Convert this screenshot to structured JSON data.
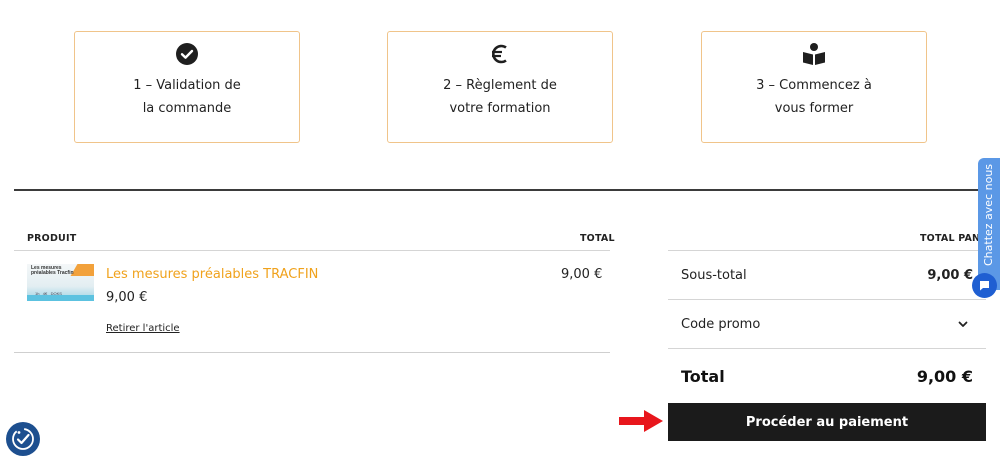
{
  "steps": [
    {
      "icon": "check-circle-icon",
      "line1": "1 – Validation de",
      "line2": "la commande"
    },
    {
      "icon": "euro-icon",
      "line1": "2 – Règlement de",
      "line2": "votre formation"
    },
    {
      "icon": "reader-icon",
      "line1": "3 – Commencez à",
      "line2": "vous former"
    }
  ],
  "cart": {
    "col_product": "PRODUIT",
    "col_total": "TOTAL",
    "item": {
      "name": "Les mesures préalables TRACFIN",
      "price": "9,00 €",
      "remove_label": "Retirer l'article",
      "total": "9,00 €",
      "thumbnail_text": "Les mesures préalables Tracfin"
    }
  },
  "summary": {
    "header": "TOTAL PANIER",
    "subtotal_label": "Sous-total",
    "subtotal_value": "9,00 €",
    "promo_label": "Code promo",
    "total_label": "Total",
    "total_value": "9,00 €",
    "checkout_label": "Procéder au paiement"
  },
  "chat": {
    "tab_label": "Chattez avec nous"
  },
  "colors": {
    "accent_orange": "#f0a21c",
    "card_border": "#f0c48a",
    "button_dark": "#1b1b1b",
    "chat_blue": "#5b98e6",
    "arrow_red": "#e8161c"
  }
}
